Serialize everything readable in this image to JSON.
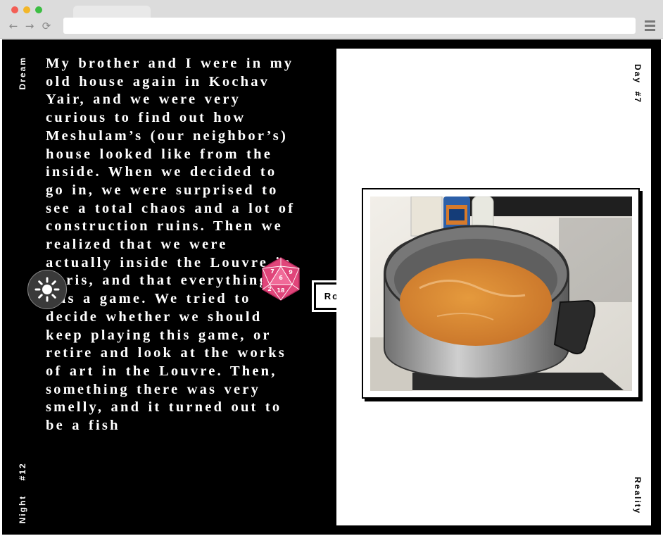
{
  "browser": {
    "back_glyph": "←",
    "forward_glyph": "→",
    "reload_glyph": "⟳",
    "menu_icon": "hamburger-menu-icon"
  },
  "dream": {
    "label": "Dream",
    "night_label": "Night",
    "night_number": "#12",
    "text": "My brother and I were in my old house again in Kochav Yair, and we were very curious to find out how Meshulam’s (our neighbor’s) house looked like from the inside. When we decided to go in, we were surprised to see a total chaos and a lot of construction ruins. Then we realized that we were actually inside the Louvre in Paris, and that everything was a game. We tried to decide whether we should keep playing this game, or retire and look at the works of art in the Louvre. Then, something there was very smelly, and it turned out to be a fish"
  },
  "controls": {
    "roll_label": "Roll",
    "theme_icon": "sun-icon",
    "dice_icon": "d20-dice-icon",
    "dice_color": "#e0457a"
  },
  "reality": {
    "day_label": "Day",
    "day_number": "#7",
    "label": "Reality",
    "photo_icon": "cooking-pot-photo"
  }
}
